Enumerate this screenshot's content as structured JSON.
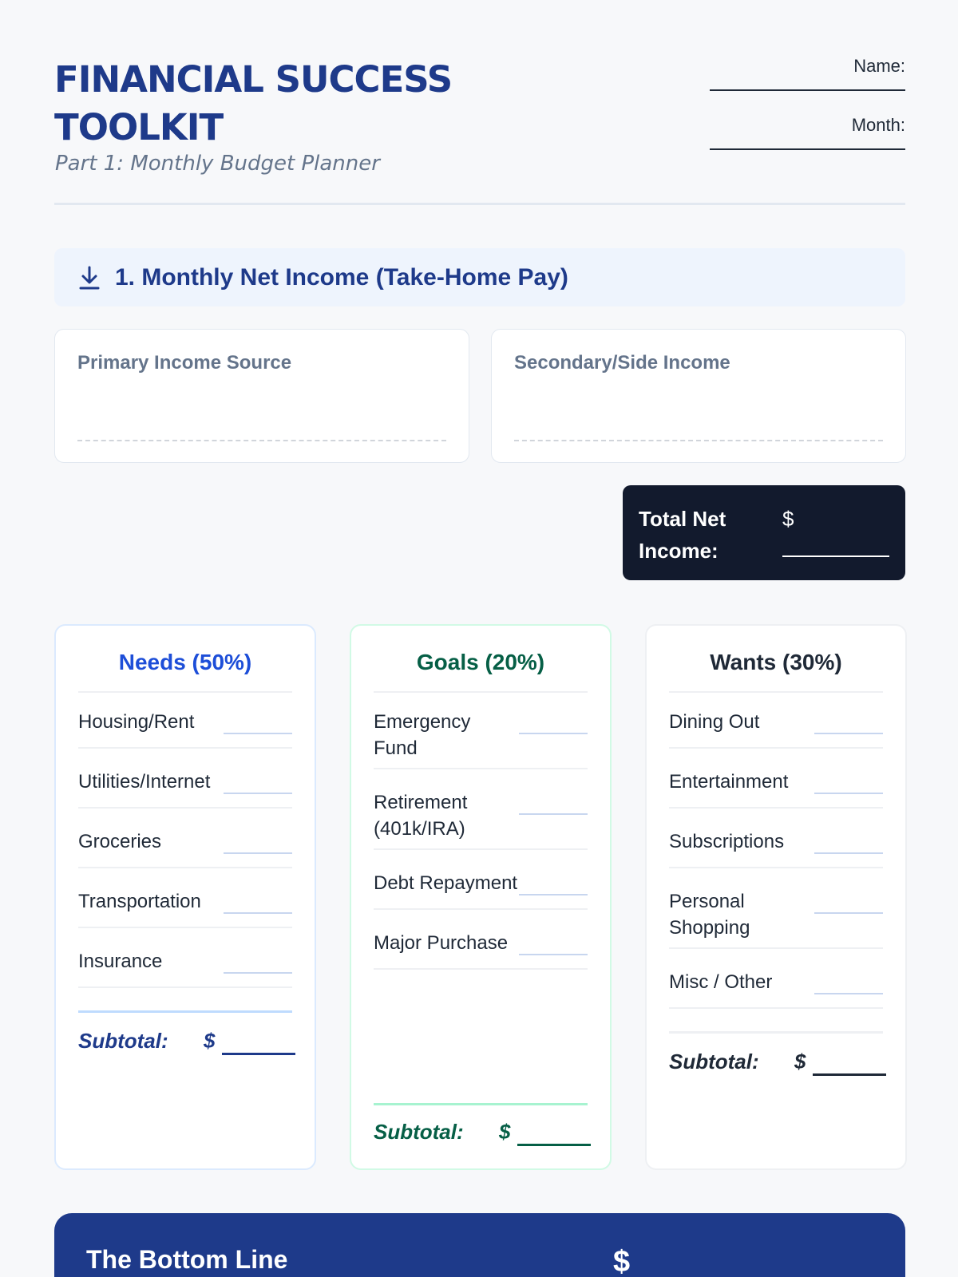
{
  "header": {
    "title_line1": "FINANCIAL SUCCESS",
    "title_line2": "TOOLKIT",
    "subtitle": "Part 1: Monthly Budget Planner",
    "name_label": "Name:",
    "month_label": "Month:"
  },
  "income": {
    "section_title": "1. Monthly Net Income (Take-Home Pay)",
    "icon": "download-arrow-icon",
    "primary_label": "Primary Income Source",
    "secondary_label": "Secondary/Side Income",
    "total_label": "Total Net Income:",
    "total_currency": "$"
  },
  "columns": {
    "needs": {
      "title": "Needs (50%)",
      "items": [
        "Housing/Rent",
        "Utilities/Internet",
        "Groceries",
        "Transportation",
        "Insurance"
      ],
      "subtotal_label": "Subtotal:",
      "currency": "$"
    },
    "goals": {
      "title": "Goals (20%)",
      "items": [
        "Emergency Fund",
        "Retirement (401k/IRA)",
        "Debt Repayment",
        "Major Purchase"
      ],
      "subtotal_label": "Subtotal:",
      "currency": "$"
    },
    "wants": {
      "title": "Wants (30%)",
      "items": [
        "Dining Out",
        "Entertainment",
        "Subscriptions",
        "Personal Shopping",
        "Misc / Other"
      ],
      "subtotal_label": "Subtotal:",
      "currency": "$"
    }
  },
  "bottom_line": {
    "title": "The Bottom Line",
    "currency": "$"
  },
  "colors": {
    "brand_navy": "#1e3a8a",
    "needs_blue": "#1d4ed8",
    "goals_green": "#065f46",
    "dark_box": "#121a2d"
  }
}
